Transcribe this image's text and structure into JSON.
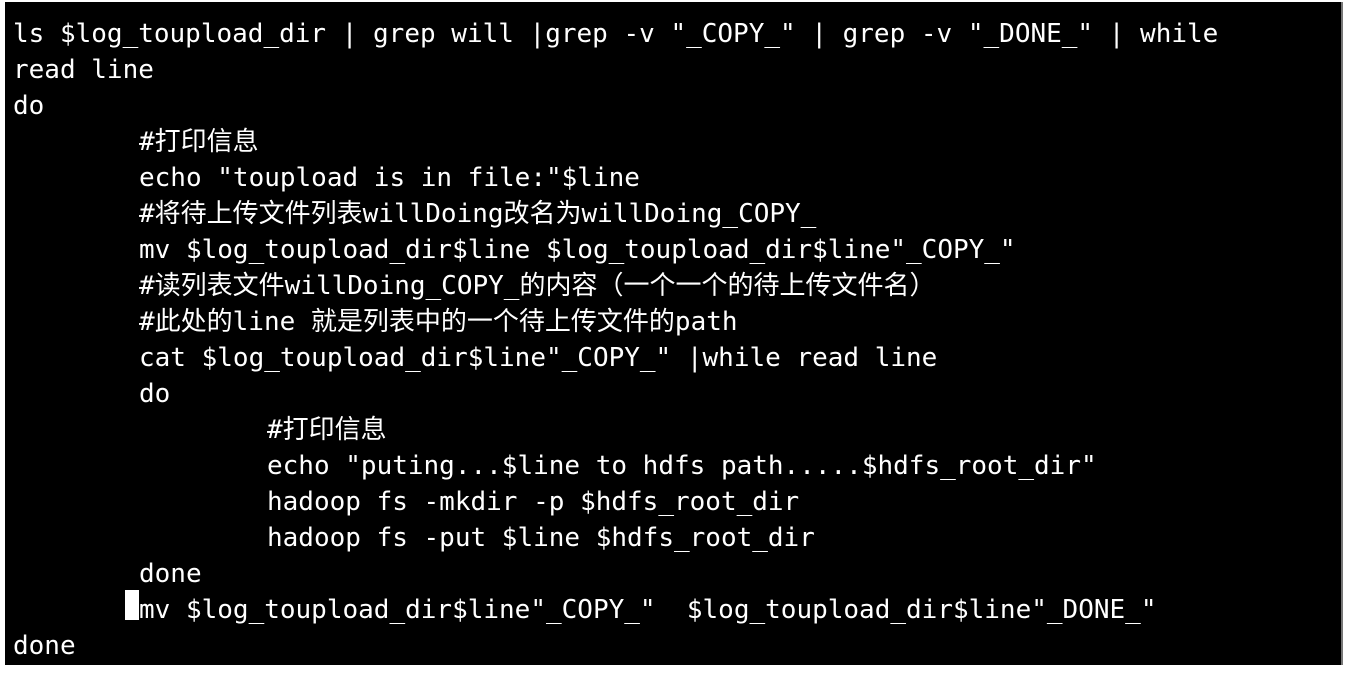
{
  "terminal": {
    "lines": [
      "ls $log_toupload_dir | grep will |grep -v \"_COPY_\" | grep -v \"_DONE_\" | while",
      "read line",
      "do",
      "#打印信息",
      "echo \"toupload is in file:\"$line",
      "#将待上传文件列表willDoing改名为willDoing_COPY_",
      "mv $log_toupload_dir$line $log_toupload_dir$line\"_COPY_\"",
      "#读列表文件willDoing_COPY_的内容（一个一个的待上传文件名）",
      "#此处的line 就是列表中的一个待上传文件的path",
      "cat $log_toupload_dir$line\"_COPY_\" |while read line",
      "do",
      "#打印信息",
      "echo \"puting...$line to hdfs path.....$hdfs_root_dir\"",
      "hadoop fs -mkdir -p $hdfs_root_dir",
      "hadoop fs -put $line $hdfs_root_dir",
      "done",
      "mv $log_toupload_dir$line\"_COPY_\"  $log_toupload_dir$line\"_DONE_\"",
      "done"
    ]
  },
  "colors": {
    "background": "#000000",
    "text": "#ffffff",
    "cursor": "#ffffff"
  }
}
